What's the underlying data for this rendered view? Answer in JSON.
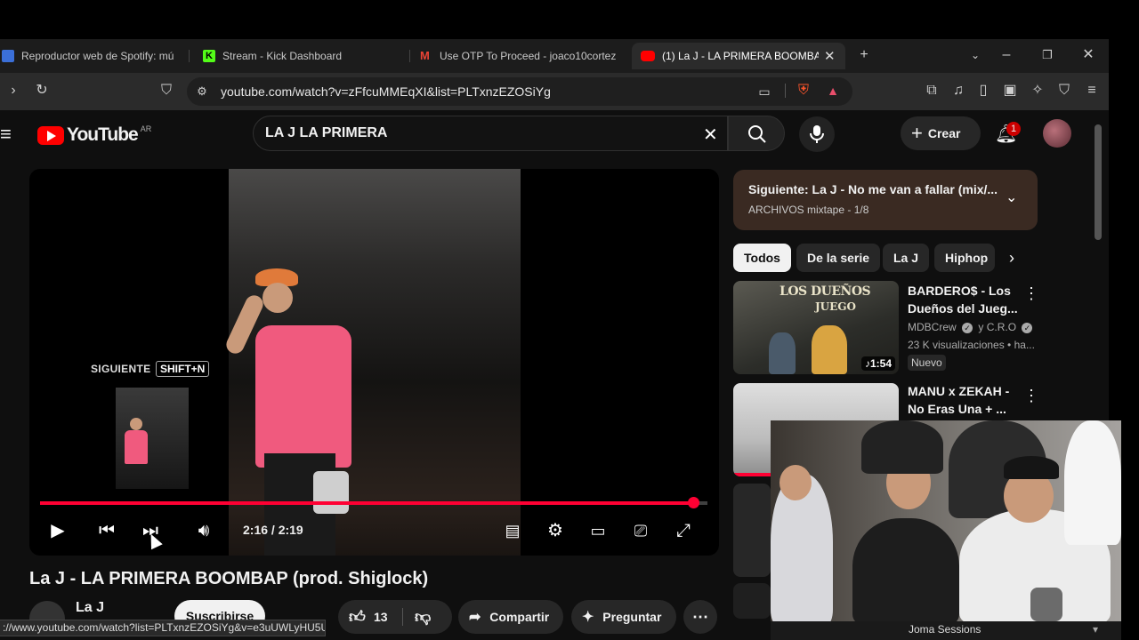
{
  "browser": {
    "tabs": [
      {
        "label": "Reproductor web de Spotify: mú",
        "icon": "spotify-icon",
        "color": "#3b6fd8"
      },
      {
        "label": "Stream - Kick Dashboard",
        "icon": "kick-icon",
        "color": "#53fc18"
      },
      {
        "label": "Use OTP To Proceed - joaco10cortez",
        "icon": "gmail-icon",
        "color": "#ea4335"
      },
      {
        "label": "(1) La J - LA PRIMERA BOOMBAP",
        "icon": "youtube-icon",
        "color": "#ff0000",
        "active": true
      }
    ],
    "url": "youtube.com/watch?v=zFfcuMMEqXI&list=PLTxnzEZOSiYg",
    "status_url": "://www.youtube.com/watch?list=PLTxnzEZOSiYg&v=e3uUWLyHU5U"
  },
  "youtube": {
    "logo_text": "YouTube",
    "country_code": "AR",
    "search_value": "LA J LA PRIMERA",
    "create_label": "Crear",
    "notification_count": "1",
    "player": {
      "time": "2:16 / 2:19",
      "progress": 0.978,
      "next_label": "SIGUIENTE",
      "next_shortcut": "SHIFT+N"
    },
    "video_title": "La J - LA PRIMERA BOOMBAP (prod. Shiglock)",
    "channel_name": "La J",
    "subscribe_label": "Suscribirse",
    "like_count": "13",
    "share_label": "Compartir",
    "ask_label": "Preguntar",
    "up_next": {
      "title": "Siguiente: La J - No me van a fallar (mix/...",
      "subtitle": "ARCHIVOS mixtape - 1/8"
    },
    "chips": [
      "Todos",
      "De la serie",
      "La J",
      "Hiphop"
    ],
    "recommendations": [
      {
        "title_line1": "BARDERO$ - Los",
        "title_line2": "Dueños del Jueg...",
        "channel": "MDBCrew",
        "channel_extra": "y C.R.O",
        "views": "23 K visualizaciones • ha...",
        "badge": "Nuevo",
        "duration": "1:54",
        "thumb_text_1": "LOS DUEÑOS",
        "thumb_text_2": "JUEGO"
      },
      {
        "title_line1": "MANU x ZEKAH -",
        "title_line2": "No Eras Una + ..."
      }
    ],
    "webcam_overlay_label": "Joma Sessions"
  }
}
